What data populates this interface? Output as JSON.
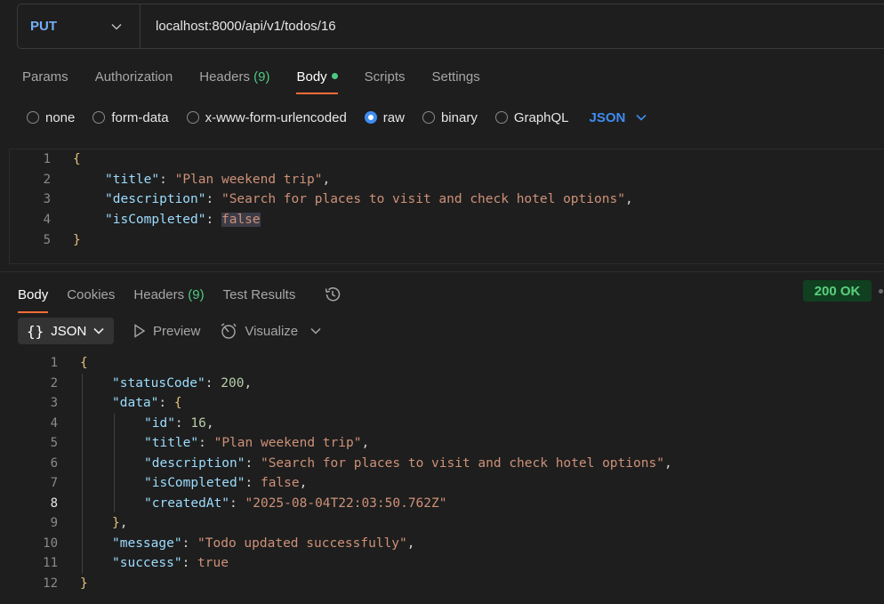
{
  "request": {
    "method": "PUT",
    "url": "localhost:8000/api/v1/todos/16"
  },
  "request_tabs": [
    {
      "label": "Params"
    },
    {
      "label": "Authorization"
    },
    {
      "label": "Headers",
      "count": "(9)"
    },
    {
      "label": "Body"
    },
    {
      "label": "Scripts"
    },
    {
      "label": "Settings"
    }
  ],
  "body_types": [
    "none",
    "form-data",
    "x-www-form-urlencoded",
    "raw",
    "binary",
    "GraphQL"
  ],
  "body_format": "JSON",
  "request_body": {
    "title": "Plan weekend trip",
    "description": "Search for places to visit and check hotel options",
    "isCompleted": "false"
  },
  "response_tabs": [
    {
      "label": "Body"
    },
    {
      "label": "Cookies"
    },
    {
      "label": "Headers",
      "count": "(9)"
    },
    {
      "label": "Test Results"
    }
  ],
  "response_status": "200 OK",
  "response_toolbar": {
    "format": "JSON",
    "preview": "Preview",
    "visualize": "Visualize"
  },
  "response_body": {
    "statusCode": "200",
    "id": "16",
    "title": "Plan weekend trip",
    "description": "Search for places to visit and check hotel options",
    "isCompleted": "false",
    "createdAt": "2025-08-04T22:03:50.762Z",
    "message": "Todo updated successfully",
    "success": "true"
  },
  "line_numbers": [
    "1",
    "2",
    "3",
    "4",
    "5",
    "6",
    "7",
    "8",
    "9",
    "10",
    "11",
    "12"
  ]
}
